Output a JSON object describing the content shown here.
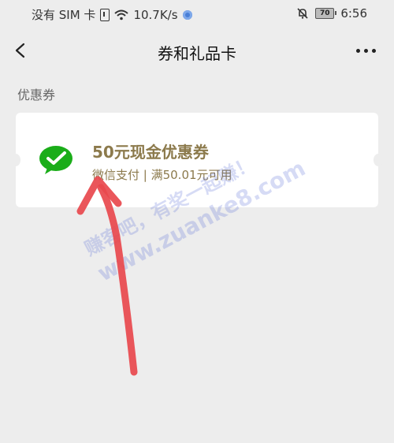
{
  "status_bar": {
    "carrier": "没有 SIM 卡",
    "speed": "10.7K/s",
    "battery": "70",
    "time": "6:56"
  },
  "nav": {
    "title": "券和礼品卡"
  },
  "section": {
    "label": "优惠券"
  },
  "coupon": {
    "title": "50元现金优惠券",
    "description": "微信支付 | 满50.01元可用",
    "icon": "wechat-pay-icon",
    "accent_color": "#8c7a4c"
  },
  "watermark": {
    "line1": "赚客吧，有奖一起赚！",
    "line2": "www.zuanke8.com"
  },
  "annotation": {
    "arrow_color": "#e8484d"
  }
}
